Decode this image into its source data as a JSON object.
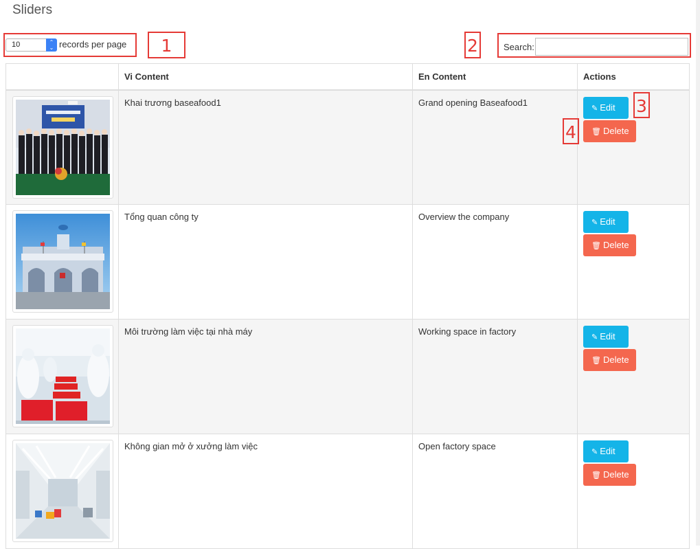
{
  "page": {
    "title": "Sliders"
  },
  "length": {
    "value": "10",
    "label": "records per page",
    "arrow_glyph": "⌃⌄"
  },
  "search": {
    "label": "Search:",
    "value": ""
  },
  "markers": [
    "1",
    "2",
    "3",
    "4"
  ],
  "table": {
    "headers": [
      "",
      "Vi Content",
      "En Content",
      "Actions"
    ],
    "rows": [
      {
        "vi": "Khai trương baseafood1",
        "en": "Grand opening Baseafood1",
        "image": "group-photo-opening-ceremony"
      },
      {
        "vi": "Tổng quan công ty",
        "en": "Overview the company",
        "image": "factory-building-exterior"
      },
      {
        "vi": "Môi trường làm việc tại nhà máy",
        "en": "Working space in factory",
        "image": "workers-processing-line"
      },
      {
        "vi": "Không gian mở ở xưởng làm việc",
        "en": "Open factory space",
        "image": "empty-factory-hall"
      }
    ]
  },
  "actions": {
    "edit_label": "Edit",
    "delete_label": "Delete",
    "edit_icon": "pencil-square-icon",
    "delete_icon": "trash-icon"
  },
  "colors": {
    "edit": "#14b4e8",
    "delete": "#f4674e",
    "marker": "#e53935"
  }
}
